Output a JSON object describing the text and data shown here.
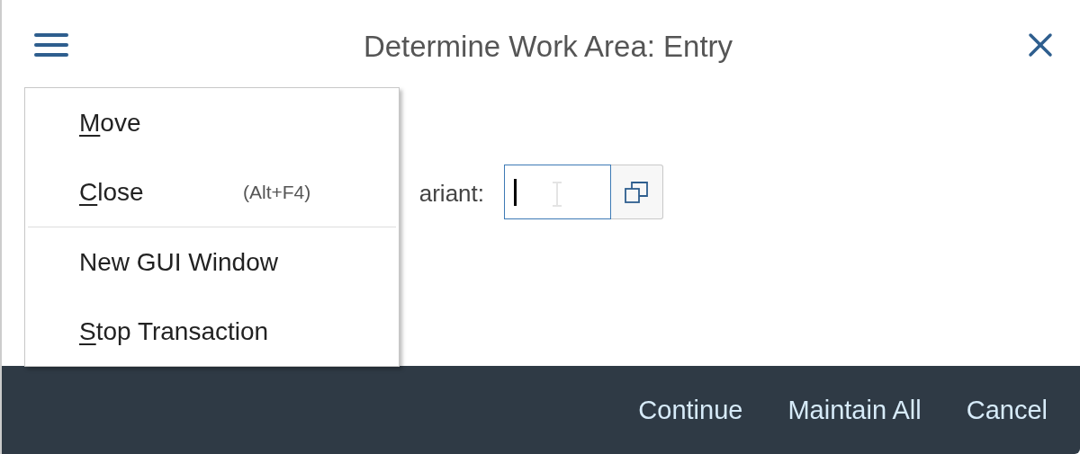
{
  "window": {
    "title": "Determine Work Area: Entry"
  },
  "form": {
    "label": "ariant:",
    "focused": true
  },
  "menu": {
    "open": true,
    "items": [
      {
        "label": "Move",
        "underline_first": true,
        "separator_after": false
      },
      {
        "label": "Close",
        "shortcut": "(Alt+F4)",
        "underline_first": true,
        "separator_after": true
      },
      {
        "label": "New GUI Window",
        "underline_first": false,
        "separator_after": false
      },
      {
        "label": "Stop Transaction",
        "underline_first": true,
        "separator_after": false
      }
    ]
  },
  "buttons": [
    "Continue",
    "Maintain All",
    "Cancel"
  ]
}
